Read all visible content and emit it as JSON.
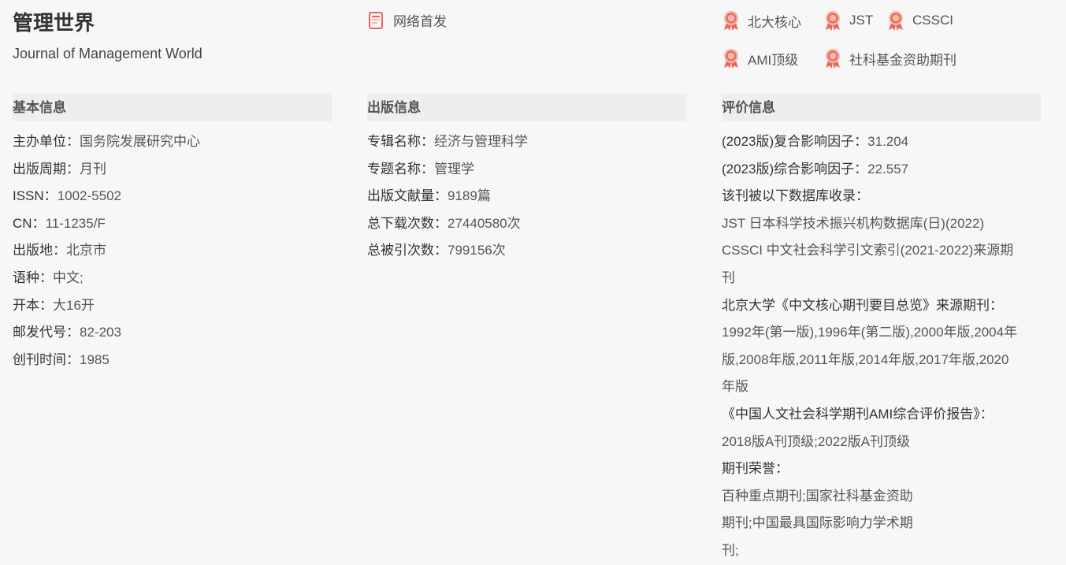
{
  "header": {
    "title": "管理世界",
    "subtitle": "Journal of Management World",
    "first_publish": "网络首发",
    "tags": [
      "北大核心",
      "JST",
      "CSSCI",
      "AMI顶级",
      "社科基金资助期刊"
    ]
  },
  "basic": {
    "heading": "基本信息",
    "rows": [
      {
        "k": "主办单位：",
        "v": "国务院发展研究中心"
      },
      {
        "k": "出版周期：",
        "v": "月刊"
      },
      {
        "k": "ISSN：",
        "v": "1002-5502"
      },
      {
        "k": "CN：",
        "v": "11-1235/F"
      },
      {
        "k": "出版地：",
        "v": "北京市"
      },
      {
        "k": "语种：",
        "v": "中文;"
      },
      {
        "k": "开本：",
        "v": "大16开"
      },
      {
        "k": "邮发代号：",
        "v": "82-203"
      },
      {
        "k": "创刊时间：",
        "v": "1985"
      }
    ]
  },
  "publish": {
    "heading": "出版信息",
    "rows": [
      {
        "k": "专辑名称：",
        "v": "经济与管理科学"
      },
      {
        "k": "专题名称：",
        "v": "管理学"
      },
      {
        "k": "出版文献量：",
        "v": "9189篇"
      },
      {
        "k": "总下载次数：",
        "v": "27440580次"
      },
      {
        "k": "总被引次数：",
        "v": "799156次"
      }
    ]
  },
  "evaluation": {
    "heading": "评价信息",
    "lines": [
      {
        "t": "(2023版)复合影响因子：",
        "v": "31.204",
        "type": "kv"
      },
      {
        "t": "(2023版)综合影响因子：",
        "v": "22.557",
        "type": "kv"
      },
      {
        "t": "该刊被以下数据库收录：",
        "type": "k"
      },
      {
        "t": "JST 日本科学技术振兴机构数据库(日)(2022)",
        "type": "v"
      },
      {
        "t": "CSSCI 中文社会科学引文索引(2021-2022)来源期",
        "type": "v"
      },
      {
        "t": "刊",
        "type": "v"
      },
      {
        "t": "北京大学《中文核心期刊要目总览》来源期刊：",
        "type": "k"
      },
      {
        "t": "1992年(第一版),1996年(第二版),2000年版,2004年",
        "type": "v"
      },
      {
        "t": "版,2008年版,2011年版,2014年版,2017年版,2020",
        "type": "v"
      },
      {
        "t": "年版",
        "type": "v"
      },
      {
        "t": "《中国人文社会科学期刊AMI综合评价报告》：",
        "type": "k"
      },
      {
        "t": "2018版A刊顶级;2022版A刊顶级",
        "type": "v"
      },
      {
        "t": "期刊荣誉：",
        "type": "k"
      },
      {
        "t": "百种重点期刊;国家社科基金资助",
        "type": "v"
      },
      {
        "t": "期刊;中国最具国际影响力学术期",
        "type": "v"
      },
      {
        "t": "刊;",
        "type": "v"
      }
    ]
  },
  "colors": {
    "icon_red": "#e8675a",
    "icon_light": "#f6b7ad",
    "section_bg": "#eeeeee"
  }
}
